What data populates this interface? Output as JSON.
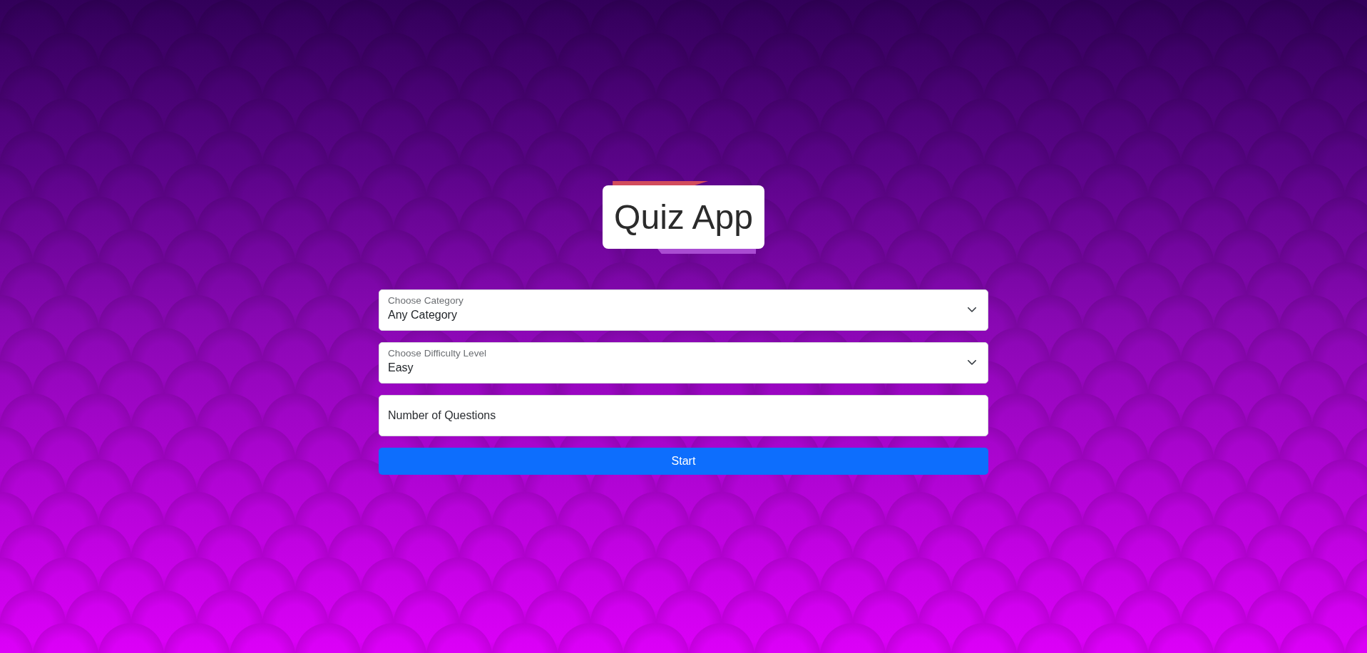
{
  "title": "Quiz App",
  "form": {
    "fields": [
      {
        "kind": "select",
        "label": "Choose Category",
        "value": "Any Category"
      },
      {
        "kind": "select",
        "label": "Choose Difficulty Level",
        "value": "Easy"
      },
      {
        "kind": "number",
        "placeholder": "Number of Questions"
      }
    ],
    "start_button": "Start"
  }
}
